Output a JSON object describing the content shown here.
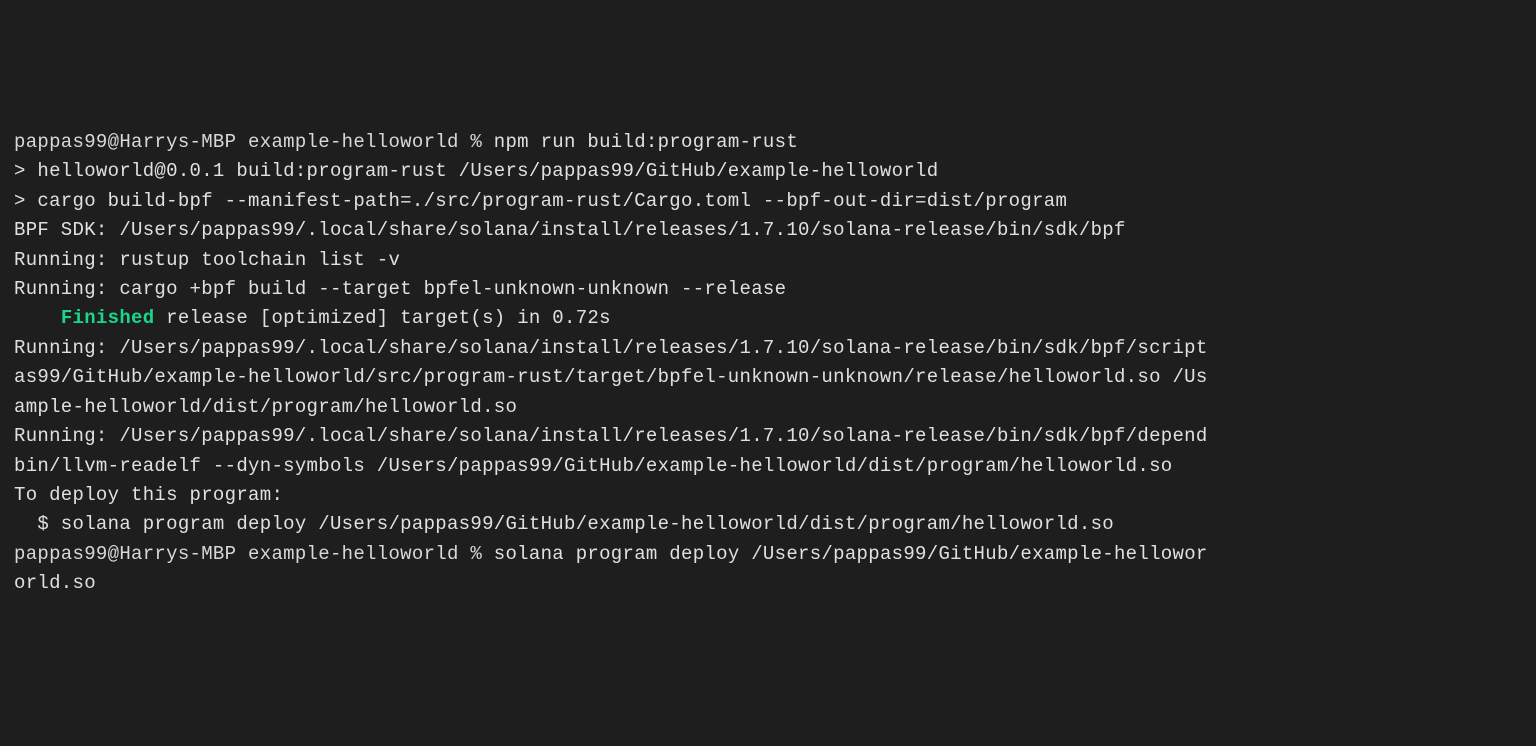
{
  "lines": {
    "l1_prompt": "pappas99@Harrys-MBP example-helloworld % ",
    "l1_cmd": "npm run build:program-rust",
    "l2": "",
    "l3": "> helloworld@0.0.1 build:program-rust /Users/pappas99/GitHub/example-helloworld",
    "l4": "> cargo build-bpf --manifest-path=./src/program-rust/Cargo.toml --bpf-out-dir=dist/program",
    "l5": "",
    "l6": "BPF SDK: /Users/pappas99/.local/share/solana/install/releases/1.7.10/solana-release/bin/sdk/bpf",
    "l7": "Running: rustup toolchain list -v",
    "l8": "Running: cargo +bpf build --target bpfel-unknown-unknown --release",
    "l9_indent": "    ",
    "l9_finished": "Finished",
    "l9_rest": " release [optimized] target(s) in 0.72s",
    "l10": "Running: /Users/pappas99/.local/share/solana/install/releases/1.7.10/solana-release/bin/sdk/bpf/script",
    "l11": "as99/GitHub/example-helloworld/src/program-rust/target/bpfel-unknown-unknown/release/helloworld.so /Us",
    "l12": "ample-helloworld/dist/program/helloworld.so",
    "l13": "Running: /Users/pappas99/.local/share/solana/install/releases/1.7.10/solana-release/bin/sdk/bpf/depend",
    "l14": "bin/llvm-readelf --dyn-symbols /Users/pappas99/GitHub/example-helloworld/dist/program/helloworld.so",
    "l15": "",
    "l16": "To deploy this program:",
    "l17": "  $ solana program deploy /Users/pappas99/GitHub/example-helloworld/dist/program/helloworld.so",
    "l18_prompt": "pappas99@Harrys-MBP example-helloworld % ",
    "l18_cmd": "solana program deploy /Users/pappas99/GitHub/example-hellowor",
    "l19": "orld.so"
  }
}
